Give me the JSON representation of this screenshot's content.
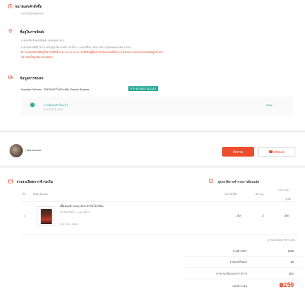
{
  "order": {
    "number_title": "หมายเลขคำสั่งซื้อ",
    "number_value": "2103247FHX9SJH"
  },
  "address": {
    "title": "ที่อยู่ในการจัดส่ง",
    "name_phone": "นายธงชัย จันทรสุริยงค์, 66959641153",
    "line1": "อาคารธรรมนิติ (ทาวเวอร์ สุขุมวิท) เลขที่ 178 ชั้น 14 แขวงสีลม เขตบางรัก กรุงเทพมหานคร 10330",
    "warning_line1": "มีการแจ้งเปลี่ยนที่อยู่ในคำสั่งซื้อนี้ 2021-03-24 10:54:31 ซึ่งที่อยู่นี้แสดงในใบแจ้งหนี้/ใบปะหน้าพัสดุ กรุณาตรวจสอบที่อยู่ในใบปะ",
    "warning_line2": "หน้าพัสดุให้ถูกต้องก่อนจัดส่ง"
  },
  "shipping": {
    "title": "ข้อมูลการขนส่ง",
    "carrier": "Standard Delivery - ส่งธรรมดาในประเทศ | Shopee Express",
    "tracking_tag": "# TH014557142313",
    "timeline_label": "การจัดส่งสำเร็จแล้ว",
    "timeline_time": "25-03-2021 10:50",
    "more_label": "ซ่อน"
  },
  "buyer": {
    "name": "fashionrose",
    "follow_label": "ติดตาม",
    "chat_label": "แชทเลย"
  },
  "payment": {
    "title": "รายละเอียดการชำระเงิน",
    "history_link": "ดูประวัติการทำรายการย้อนหลัง",
    "headers": {
      "no": "No.",
      "product": "สินค้าทั้งหมด",
      "unit_price": "ราคาต่อชิ้น",
      "qty": "จำนวน",
      "subtotal": "ราคารวม",
      "subtotal2": "สุทธิ"
    },
    "item": {
      "index": "1",
      "name": "เนื้ออบแห้ง Jerky Beef ฟาร์มโรงเรียน",
      "variant": "ตัวเลือกสินค้า: Jerky เนื้อวัว",
      "sku": "เลข SKU: jb060",
      "unit_price": "140",
      "qty": "2",
      "subtotal": "280"
    },
    "expand_label": "ดูรายละเอียดการชำระเงิน",
    "summary": [
      {
        "label": "รวมค่าสินค้า",
        "value": "฿280"
      },
      {
        "label": "ค่าจัดส่งทั้งหมด",
        "value": "฿0"
      },
      {
        "label": "ค่าธรรมเนียมและค่าบริการ",
        "value": "-฿21"
      }
    ],
    "total_label": "ยอดชำระเงิน",
    "total_value": "฿259"
  },
  "colors": {
    "accent": "#ee4d2d",
    "teal": "#26aa99"
  }
}
